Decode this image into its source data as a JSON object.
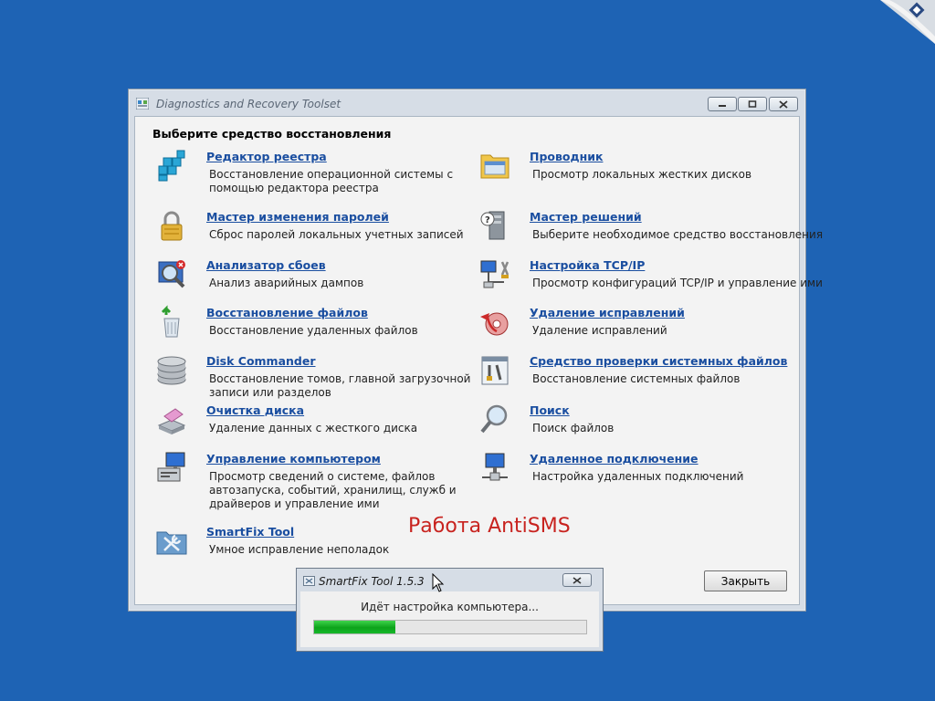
{
  "window": {
    "title": "Diagnostics and Recovery Toolset",
    "heading": "Выберите средство восстановления",
    "close_button": "Закрыть"
  },
  "tools_left": [
    {
      "icon": "registry-editor-icon",
      "label": "Редактор реестра",
      "desc": "Восстановление операционной системы с помощью редактора реестра"
    },
    {
      "icon": "lock-icon",
      "label": "Мастер изменения паролей",
      "desc": "Сброс паролей локальных учетных записей"
    },
    {
      "icon": "crash-analyzer-icon",
      "label": "Анализатор сбоев",
      "desc": "Анализ аварийных дампов"
    },
    {
      "icon": "recycle-bin-icon",
      "label": "Восстановление файлов",
      "desc": "Восстановление удаленных файлов"
    },
    {
      "icon": "disk-stack-icon",
      "label": "Disk Commander",
      "desc": "Восстановление томов, главной загрузочной записи или разделов"
    },
    {
      "icon": "eraser-disk-icon",
      "label": "Очистка диска",
      "desc": "Удаление данных с жесткого диска"
    },
    {
      "icon": "computer-management-icon",
      "label": "Управление компьютером",
      "desc": "Просмотр сведений о системе, файлов автозапуска, событий, хранилищ, служб и драйверов и управление ими"
    },
    {
      "icon": "toolbox-icon",
      "label": "SmartFix Tool",
      "desc": "Умное исправление неполадок"
    }
  ],
  "tools_right": [
    {
      "icon": "explorer-folder-icon",
      "label": "Проводник",
      "desc": "Просмотр локальных жестких дисков"
    },
    {
      "icon": "solution-wizard-icon",
      "label": "Мастер решений",
      "desc": "Выберите необходимое средство восстановления"
    },
    {
      "icon": "network-config-icon",
      "label": "Настройка TCP/IP",
      "desc": "Просмотр конфигураций TCP/IP и управление ими"
    },
    {
      "icon": "hotfix-uninstall-icon",
      "label": "Удаление исправлений",
      "desc": "Удаление исправлений"
    },
    {
      "icon": "system-file-checker-icon",
      "label": "Средство проверки системных файлов",
      "desc": "Восстановление системных файлов"
    },
    {
      "icon": "magnifier-icon",
      "label": "Поиск",
      "desc": "Поиск файлов"
    },
    {
      "icon": "remote-connection-icon",
      "label": "Удаленное подключение",
      "desc": "Настройка удаленных подключений"
    }
  ],
  "watermark": "Работа AntiSMS",
  "dialog": {
    "title": "SmartFix Tool 1.5.3",
    "message": "Идёт настройка компьютера...",
    "progress": 0.3
  }
}
